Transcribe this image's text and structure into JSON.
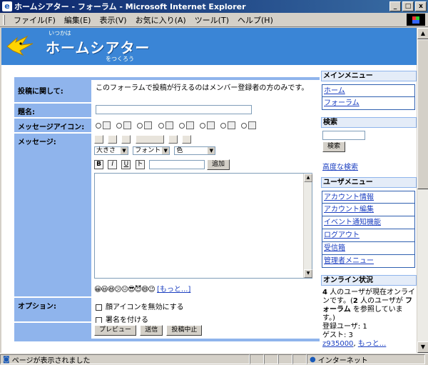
{
  "window": {
    "title": "ホームシアター - フォーラム - Microsoft Internet Explorer",
    "btn_min": "_",
    "btn_max": "□",
    "btn_close": "x"
  },
  "menubar": {
    "items": [
      "ファイル(F)",
      "編集(E)",
      "表示(V)",
      "お気に入り(A)",
      "ツール(T)",
      "ヘルプ(H)"
    ]
  },
  "banner": {
    "sub1": "いつかは",
    "title": "ホームシアター",
    "sub2": "をつくろう"
  },
  "form": {
    "about_label": "投稿に関して:",
    "about_text": "このフォーラムで投稿が行えるのはメンバー登録者の方のみです。",
    "subject_label": "題名:",
    "subject_value": "",
    "msgicon_label": "メッセージアイコン:",
    "message_label": "メッセージ:",
    "size_select": "大きさ",
    "font_select": "フォント",
    "color_select": "色",
    "bold": "B",
    "italic": "I",
    "underline": "U",
    "strike": "ト",
    "add_button": "追加",
    "more_link": "[もっと...]",
    "options_label": "オプション:",
    "option1": "顔アイコンを無効にする",
    "option2": "署名を付ける",
    "preview_button": "プレビュー",
    "submit_button": "送信",
    "cancel_button": "投稿中止"
  },
  "sidebar": {
    "main_menu_title": "メインメニュー",
    "main_menu": [
      "ホーム",
      "フォーラム"
    ],
    "search_title": "検索",
    "search_value": "",
    "search_button": "検索",
    "advanced_search": "高度な検索",
    "user_menu_title": "ユーザメニュー",
    "user_menu": [
      "アカウント情報",
      "アカウント編集",
      "イベント通知機能",
      "ログアウト",
      "受信箱",
      "管理者メニュー"
    ],
    "online_title": "オンライン状況",
    "online_count": "4",
    "online_text1": " 人のユーザが現在オンラインです。(",
    "online_count2": "2",
    "online_text2": " 人のユーザが ",
    "online_forum": "フォーラム",
    "online_text3": " を参照しています。)",
    "registered": "登録ユーザ: 1",
    "guests": "ゲスト: 3",
    "user_link": "z935000",
    "more_link": "もっと..."
  },
  "status": {
    "text": "ページが表示されました",
    "zone": "インターネット"
  }
}
